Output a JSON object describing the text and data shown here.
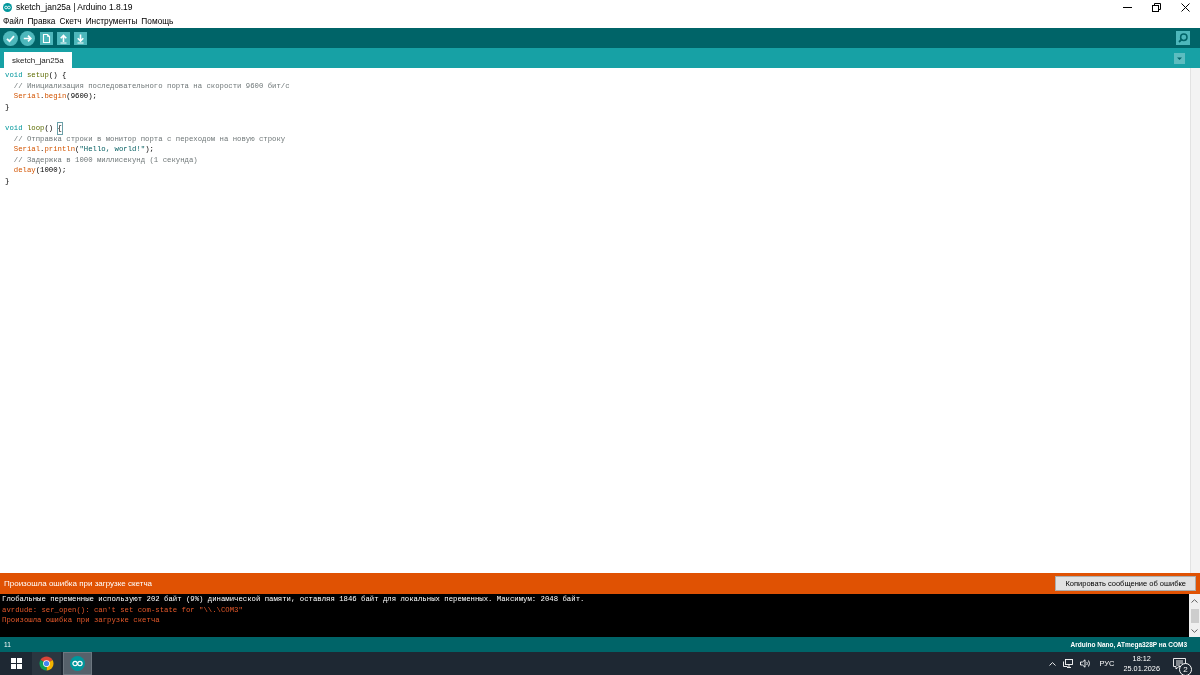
{
  "window": {
    "title": "sketch_jan25a | Arduino 1.8.19"
  },
  "menu": [
    "Файл",
    "Правка",
    "Скетч",
    "Инструменты",
    "Помощь"
  ],
  "tabs": [
    {
      "label": "sketch_jan25a",
      "selected": true
    }
  ],
  "editor": {
    "blocks": [
      {
        "lines": [
          {
            "tokens": [
              {
                "text": "void ",
                "kind": "keyword",
                "matched": false
              },
              {
                "text": "setup",
                "kind": "function",
                "matched": false
              },
              {
                "text": "() {",
                "kind": "plain",
                "matched": false
              }
            ],
            "children": [
              {
                "tokens": [
                  {
                    "text": "// Инициализация последовательного порта на скорости 9600 бит/с",
                    "kind": "comment",
                    "matched": false
                  }
                ]
              },
              {
                "tokens": [
                  {
                    "text": "Serial",
                    "kind": "builtin",
                    "matched": false
                  },
                  {
                    "text": ".",
                    "kind": "plain",
                    "matched": false
                  },
                  {
                    "text": "begin",
                    "kind": "builtin",
                    "matched": false
                  },
                  {
                    "text": "(9600);",
                    "kind": "plain",
                    "matched": false
                  }
                ]
              }
            ]
          },
          {
            "tokens": [
              {
                "text": "}",
                "kind": "plain",
                "matched": false
              }
            ]
          }
        ]
      },
      {
        "lines": [
          {
            "tokens": [
              {
                "text": "void ",
                "kind": "keyword",
                "matched": false
              },
              {
                "text": "loop",
                "kind": "function",
                "matched": false
              },
              {
                "text": "() ",
                "kind": "plain",
                "matched": false
              },
              {
                "text": "{",
                "kind": "plain",
                "matched": true
              }
            ],
            "children": [
              {
                "tokens": [
                  {
                    "text": "// Отправка строки в монитор порта с переходом на новую строку",
                    "kind": "comment",
                    "matched": false
                  }
                ]
              },
              {
                "tokens": [
                  {
                    "text": "Serial",
                    "kind": "builtin",
                    "matched": false
                  },
                  {
                    "text": ".",
                    "kind": "plain",
                    "matched": false
                  },
                  {
                    "text": "println",
                    "kind": "builtin",
                    "matched": false
                  },
                  {
                    "text": "(",
                    "kind": "plain",
                    "matched": false
                  },
                  {
                    "text": "\"Hello, world!\"",
                    "kind": "string",
                    "matched": false
                  },
                  {
                    "text": ");",
                    "kind": "plain",
                    "matched": false
                  }
                ]
              },
              {
                "tokens": [
                  {
                    "text": "// Задержка в 1000 миллисекунд (1 секунда)",
                    "kind": "comment",
                    "matched": false
                  }
                ]
              },
              {
                "tokens": [
                  {
                    "text": "delay",
                    "kind": "builtin",
                    "matched": false
                  },
                  {
                    "text": "(1000);",
                    "kind": "plain",
                    "matched": false
                  }
                ]
              }
            ]
          },
          {
            "tokens": [
              {
                "text": "}",
                "kind": "plain",
                "matched": false
              }
            ]
          }
        ]
      }
    ]
  },
  "error_bar": {
    "message": "Произошла ошибка при загрузке скетча",
    "button": "Копировать сообщение об ошибке"
  },
  "console": {
    "lines": [
      {
        "text": "Глобальные переменные используют 202 байт (9%) динамической памяти, оставляя 1846 байт для локальных переменных. Максимум: 2048 байт.",
        "kind": "info"
      },
      {
        "text": "avrdude: ser_open(): can't set com-state for \"\\\\.\\COM3\"",
        "kind": "error"
      },
      {
        "text": "Произошла ошибка при загрузке скетча",
        "kind": "error"
      }
    ]
  },
  "status_bar": {
    "line": "11",
    "board": "Arduino Nano, ATmega328P на COM3"
  },
  "taskbar": {
    "apps": [
      {
        "kind": "browser",
        "selected": false
      },
      {
        "kind": "arduino",
        "selected": true
      }
    ],
    "tray": {
      "language": "РУС",
      "time": "18:12",
      "date": "25.01.2026",
      "notifications": "2"
    }
  }
}
